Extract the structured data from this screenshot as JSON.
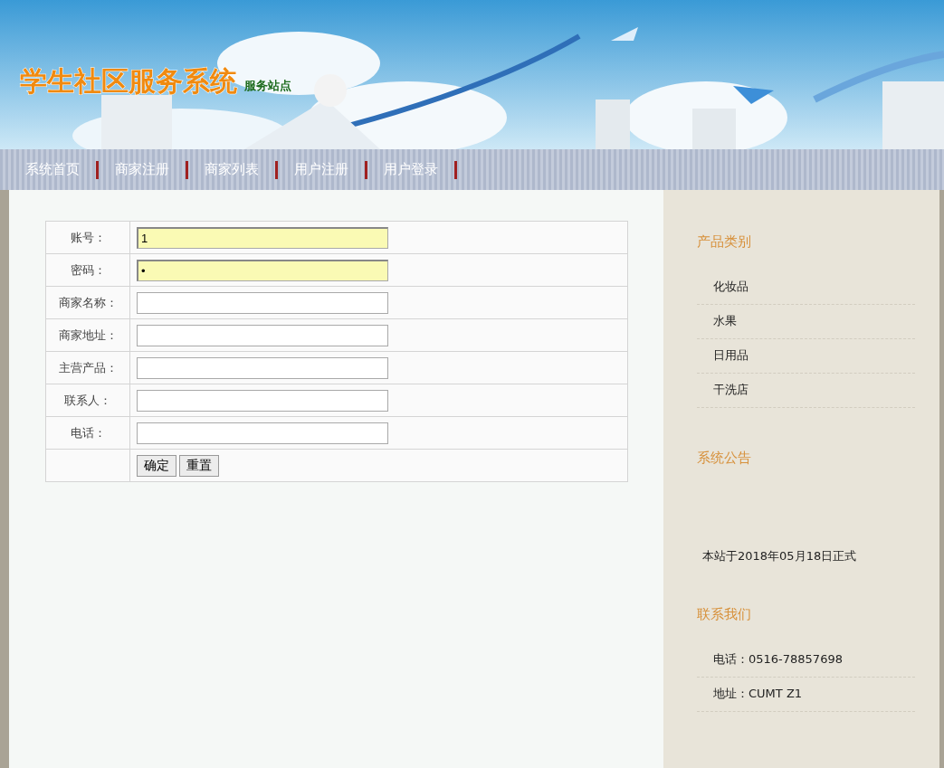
{
  "header": {
    "title": "学生社区服务系统",
    "subtitle": "服务站点"
  },
  "nav": [
    {
      "label": "系统首页"
    },
    {
      "label": "商家注册"
    },
    {
      "label": "商家列表"
    },
    {
      "label": "用户注册"
    },
    {
      "label": "用户登录"
    }
  ],
  "form": {
    "fields": [
      {
        "label": "账号：",
        "value": "1",
        "autofilled": true
      },
      {
        "label": "密码：",
        "value": "•",
        "autofilled": true
      },
      {
        "label": "商家名称：",
        "autofilled": false
      },
      {
        "label": "商家地址：",
        "autofilled": false
      },
      {
        "label": "主营产品：",
        "autofilled": false
      },
      {
        "label": "联系人：",
        "autofilled": false
      },
      {
        "label": "电话：",
        "autofilled": false
      }
    ],
    "buttons": [
      "确定",
      "重置"
    ]
  },
  "sidebar": {
    "sections": [
      {
        "title": "产品类别",
        "kind": "list",
        "items": [
          "化妆品",
          "水果",
          "日用品",
          "干洗店"
        ]
      },
      {
        "title": "系统公告",
        "kind": "notice",
        "text": "本站于2018年05月18日正式"
      },
      {
        "title": "联系我们",
        "kind": "list",
        "items": [
          "电话：0516-78857698",
          "地址：CUMT Z1"
        ]
      }
    ]
  }
}
